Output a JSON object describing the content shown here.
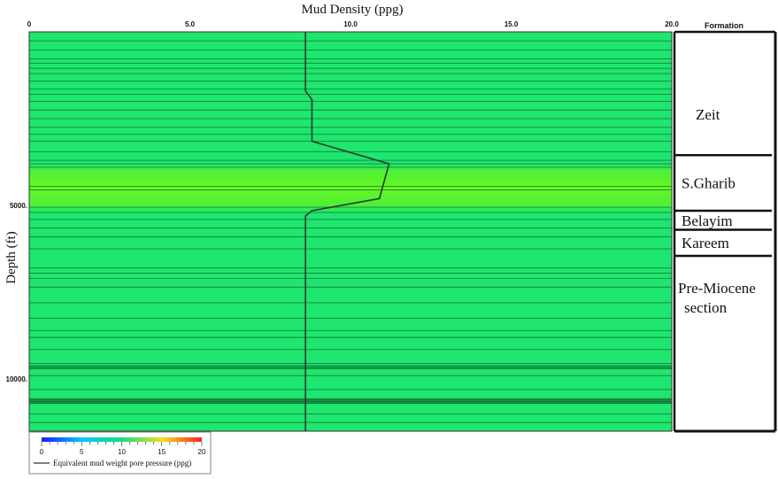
{
  "chart_data": {
    "type": "line",
    "title": "",
    "xlabel": "Mud Density (ppg)",
    "ylabel": "Depth (ft)",
    "xlim": [
      0,
      20
    ],
    "ylim": [
      0,
      11500
    ],
    "x_ticks": [
      "0",
      "5.0",
      "10.0",
      "15.0",
      "20.0"
    ],
    "x_tick_values": [
      0,
      5,
      10,
      15,
      20
    ],
    "y_ticks": [
      "5000.",
      "10000."
    ],
    "y_tick_values": [
      5000,
      10000
    ],
    "series": [
      {
        "name": "Equivalent mud weight pore pressure (ppg)",
        "color": "#2a3a2a",
        "points": [
          [
            8.6,
            0
          ],
          [
            8.6,
            1700
          ],
          [
            8.8,
            1950
          ],
          [
            8.8,
            3150
          ],
          [
            11.2,
            3800
          ],
          [
            10.9,
            4800
          ],
          [
            8.8,
            5150
          ],
          [
            8.6,
            5300
          ],
          [
            8.6,
            11500
          ]
        ]
      }
    ],
    "background_color": "#1ee66e",
    "highlight_band": {
      "depth_from": 3800,
      "depth_to": 5200,
      "color": "#5cf02c"
    },
    "layer_boundaries": [
      260,
      520,
      780,
      900,
      1050,
      1200,
      1420,
      1650,
      1800,
      2000,
      2250,
      2500,
      2750,
      2950,
      3150,
      3450,
      3700,
      3800,
      3900,
      4450,
      4550,
      5050,
      5200,
      5400,
      5650,
      5900,
      6250,
      6800,
      6950,
      7100,
      7350,
      7800,
      8250,
      8600,
      8800,
      9150,
      9550,
      9700,
      9900,
      10300,
      10600,
      10650,
      10700,
      11000,
      11250
    ],
    "dark_layers": [
      [
        9600,
        9700
      ],
      [
        10550,
        10700
      ]
    ],
    "formation_header": "Formation",
    "formations": [
      {
        "name": "Zeit",
        "top": 0,
        "bottom": 3550
      },
      {
        "name": "S.Gharib",
        "top": 3550,
        "bottom": 5150
      },
      {
        "name": "Belayim",
        "top": 5150,
        "bottom": 5700
      },
      {
        "name": "Kareem",
        "top": 5700,
        "bottom": 6450
      },
      {
        "name": "Pre-Miocene\nsection",
        "top": 6450,
        "bottom": 11500
      }
    ],
    "colorbar": {
      "min": 0,
      "max": 20,
      "tick_labels": [
        "0",
        "5",
        "10",
        "15",
        "20"
      ],
      "tick_values": [
        0,
        5,
        10,
        15,
        20
      ],
      "colors": [
        "#1a1aff",
        "#00c8ff",
        "#10e080",
        "#f0e020",
        "#ff2020"
      ],
      "legend_label": "Equivalent mud weight pore pressure (ppg)"
    }
  }
}
